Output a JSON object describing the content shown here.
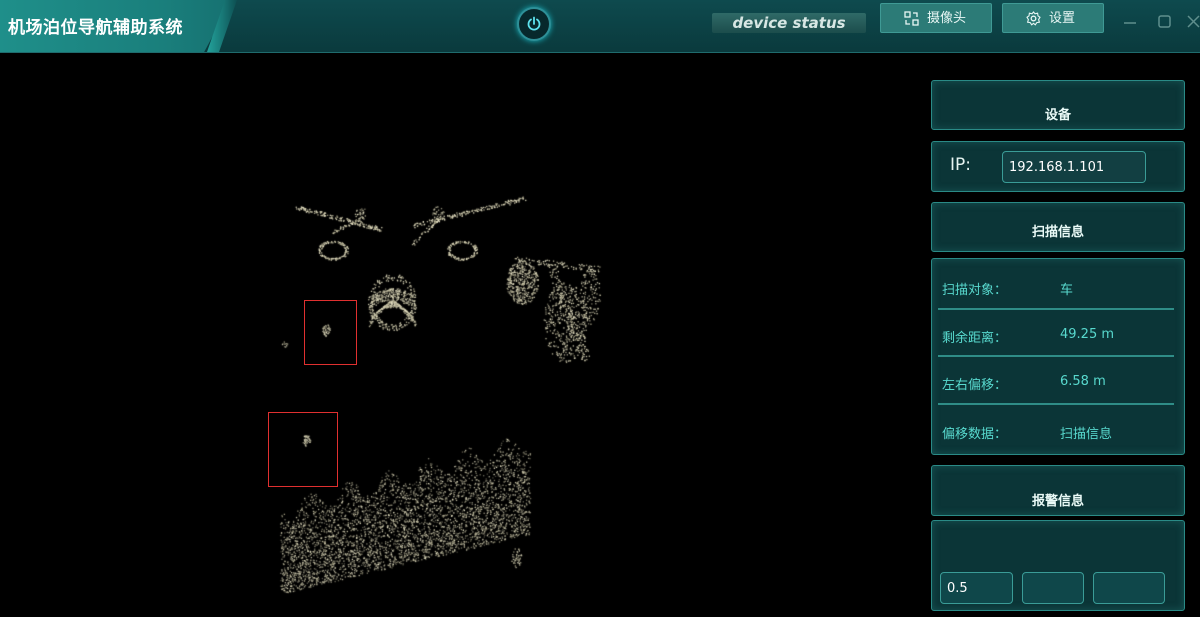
{
  "app": {
    "title": "机场泊位导航辅助系统"
  },
  "header": {
    "device_status": "device status",
    "camera_label": "摄像头",
    "settings_label": "设置"
  },
  "panel": {
    "device_header": "设备",
    "ip_label": "IP:",
    "ip_value": "192.168.1.101",
    "scan_header": "扫描信息",
    "scan_rows": [
      {
        "key": "扫描对象：",
        "value": "车"
      },
      {
        "key": "剩余距离：",
        "value": "49.25 m"
      },
      {
        "key": "左右偏移：",
        "value": "6.58 m"
      },
      {
        "key": "偏移数据：",
        "value": "扫描信息"
      }
    ],
    "alarm_header": "报警信息",
    "alarm_fields": [
      "0.5",
      "",
      ""
    ]
  },
  "colors": {
    "accent": "#1f8f8a",
    "panel_bg": "#0b3537",
    "panel_border": "#2a8a86",
    "info_text": "#58d9ce",
    "detect_box": "#e03030",
    "points": "#d9d6b8"
  }
}
